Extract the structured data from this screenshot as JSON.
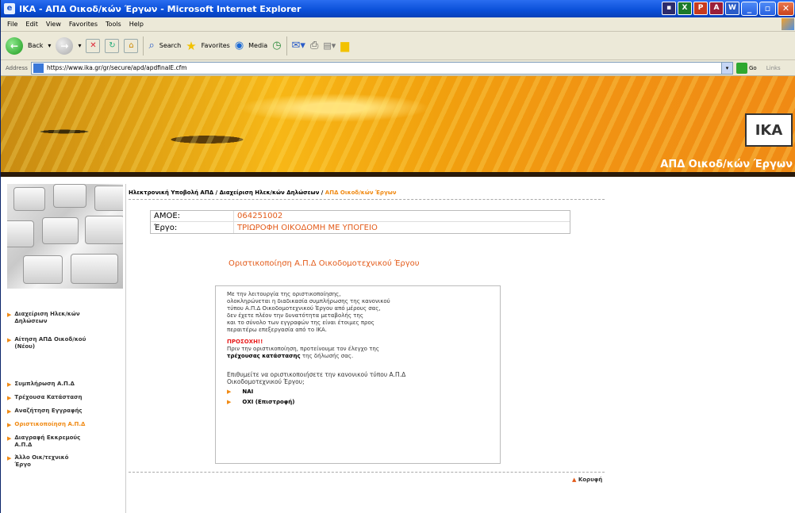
{
  "window": {
    "title": "IKA - ΑΠΔ Οικοδ/κών Έργων - Microsoft Internet Explorer"
  },
  "menubar": [
    "File",
    "Edit",
    "View",
    "Favorites",
    "Tools",
    "Help"
  ],
  "toolbar": {
    "back": "Back",
    "search": "Search",
    "favorites": "Favorites",
    "media": "Media"
  },
  "address": {
    "label": "Address",
    "url": "https://www.ika.gr/gr/secure/apd/apdfinalE.cfm",
    "go": "Go",
    "links": "Links"
  },
  "banner": {
    "logo": "IKA",
    "title": "ΑΠΔ Οικοδ/κών Έργων"
  },
  "breadcrumb": {
    "part1": "Ηλεκτρονική Υποβολή ΑΠΔ",
    "sep": " / ",
    "part2": "Διαχείριση Ηλεκ/κών Δηλώσεων",
    "current": "ΑΠΔ Οικοδ/κών Έργων"
  },
  "info": {
    "amoe_label": "ΑΜΟΕ:",
    "amoe_value": "064251002",
    "ergo_label": "Έργο:",
    "ergo_value": "ΤΡΙΩΡΟΦΗ ΟΙΚΟΔΟΜΗ ΜΕ ΥΠΟΓΕΙΟ"
  },
  "heading": "Οριστικοποίηση Α.Π.Δ Οικοδομοτεχνικού Έργου",
  "message": {
    "line1": "Με την λειτουργία της οριστικοποίησης,",
    "line2": "ολοκληρώνεται η διαδικασία συμπλήρωσης της κανονικού",
    "line3": "τύπου Α.Π.Δ Οικοδομοτεχνικού Έργου από μέρους σας,",
    "line4": "δεν έχετε πλέον την δυνατότητα μεταβολής της",
    "line5": "και το σύνολο των εγγραφών της είναι έτοιμες προς",
    "line6": "περαιτέρω επεξεργασία από το ΙΚΑ.",
    "warn": "ΠΡΟΣΟΧΗ!!",
    "warn1": "Πριν την οριστικοποίηση, προτείνουμε τον έλεγχο της",
    "warn2_bold": "τρέχουσας κατάστασης",
    "warn2_rest": " της δήλωσής σας.",
    "question1": "Επιθυμείτε να οριστικοποιήσετε την κανονικού τύπου Α.Π.Δ",
    "question2": "Οικοδομοτεχνικού Έργου;",
    "yes": "ΝΑΙ",
    "no": "ΟΧΙ (Επιστροφή)"
  },
  "sidenav": [
    {
      "label": "Διαχείριση Ηλεκ/κών Δηλώσεων",
      "active": false
    },
    {
      "label": "Αίτηση ΑΠΔ Οικοδ/κού (Νέου)",
      "active": false
    },
    {
      "label": "Συμπλήρωση Α.Π.Δ",
      "active": false
    },
    {
      "label": "Τρέχουσα Κατάσταση",
      "active": false
    },
    {
      "label": "Αναζήτηση Εγγραφής",
      "active": false
    },
    {
      "label": "Οριστικοποίηση Α.Π.Δ",
      "active": true
    },
    {
      "label": "Διαγραφή Εκκρεμούς Α.Π.Δ",
      "active": false
    },
    {
      "label": "Άλλο Οικ/τεχνικό Έργο",
      "active": false
    }
  ],
  "top_link": "Κορυφή",
  "colors": {
    "accent": "#f08a14",
    "value_red": "#e35b1a",
    "warning": "#e81b1b"
  }
}
